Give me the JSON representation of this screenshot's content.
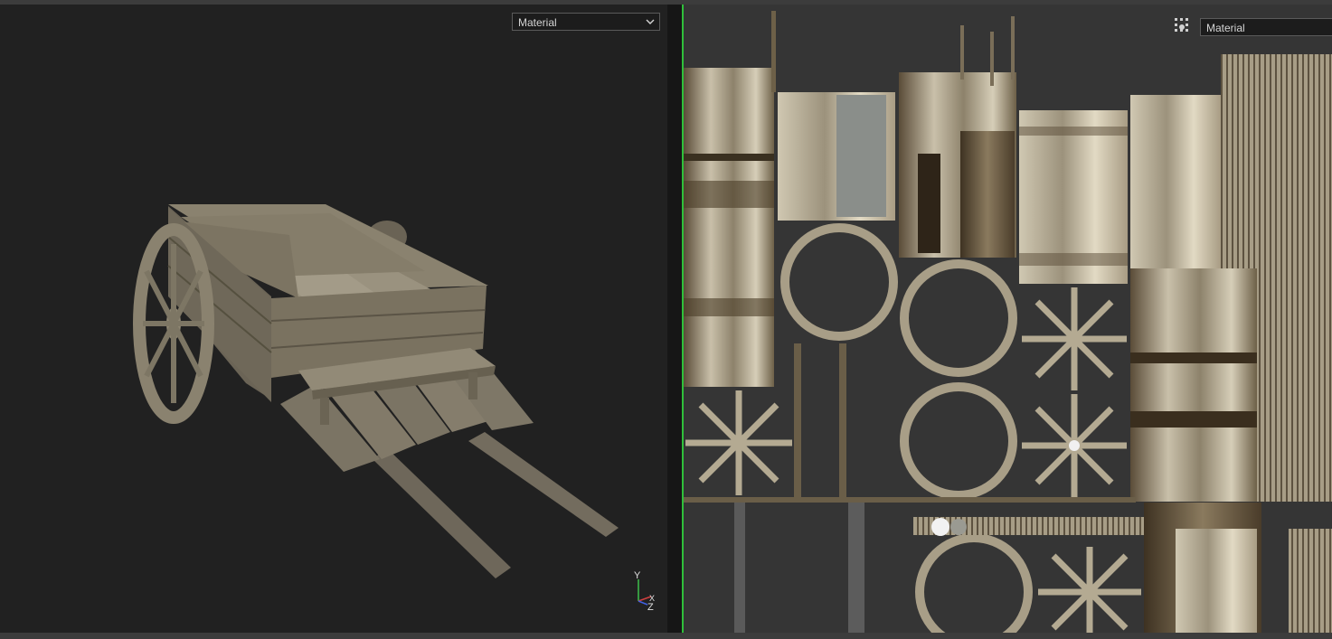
{
  "viewport": {
    "shading_mode": "Material",
    "axis_labels": {
      "y": "Y",
      "x": "X",
      "z": "Z"
    }
  },
  "uv_editor": {
    "shading_mode": "Material"
  },
  "colors": {
    "accent_uv_border": "#2fbf3a",
    "viewport_bg": "#212121",
    "uv_bg": "#353535",
    "wood": "#7a7263"
  }
}
